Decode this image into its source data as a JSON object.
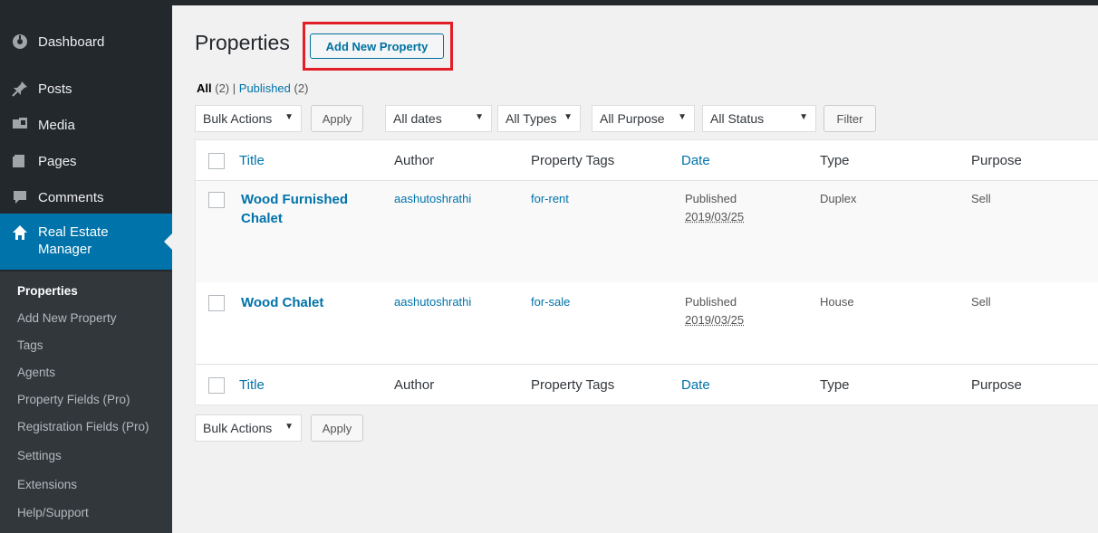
{
  "sidebar": {
    "menu": [
      {
        "label": "Dashboard",
        "icon": "dashboard-icon"
      },
      {
        "label": "Posts",
        "icon": "pin-icon"
      },
      {
        "label": "Media",
        "icon": "media-icon"
      },
      {
        "label": "Pages",
        "icon": "pages-icon"
      },
      {
        "label": "Comments",
        "icon": "comments-icon"
      },
      {
        "label": "Real Estate Manager",
        "icon": "home-icon"
      }
    ],
    "submenu": [
      "Properties",
      "Add New Property",
      "Tags",
      "Agents",
      "Property Fields (Pro)",
      "Registration Fields (Pro)",
      "Settings",
      "Extensions",
      "Help/Support"
    ]
  },
  "page": {
    "title": "Properties",
    "add_new": "Add New Property"
  },
  "views": {
    "all": "All",
    "all_count": "(2)",
    "separator": "|",
    "published": "Published",
    "published_count": "(2)"
  },
  "filters": {
    "bulk_actions": "Bulk Actions",
    "apply": "Apply",
    "dates": "All dates",
    "types": "All Types",
    "purpose": "All Purpose",
    "status": "All Status",
    "filter": "Filter"
  },
  "table": {
    "columns": [
      "Title",
      "Author",
      "Property Tags",
      "Date",
      "Type",
      "Purpose"
    ],
    "rows": [
      {
        "title": "Wood Furnished Chalet",
        "author": "aashutoshrathi",
        "tags": "for-rent",
        "date_status": "Published",
        "date": "2019/03/25",
        "type": "Duplex",
        "purpose": "Sell"
      },
      {
        "title": "Wood Chalet",
        "author": "aashutoshrathi",
        "tags": "for-sale",
        "date_status": "Published",
        "date": "2019/03/25",
        "type": "House",
        "purpose": "Sell"
      }
    ]
  },
  "colors": {
    "accent": "#0073aa",
    "sidebar": "#23282d",
    "highlight": "#e21f26"
  }
}
